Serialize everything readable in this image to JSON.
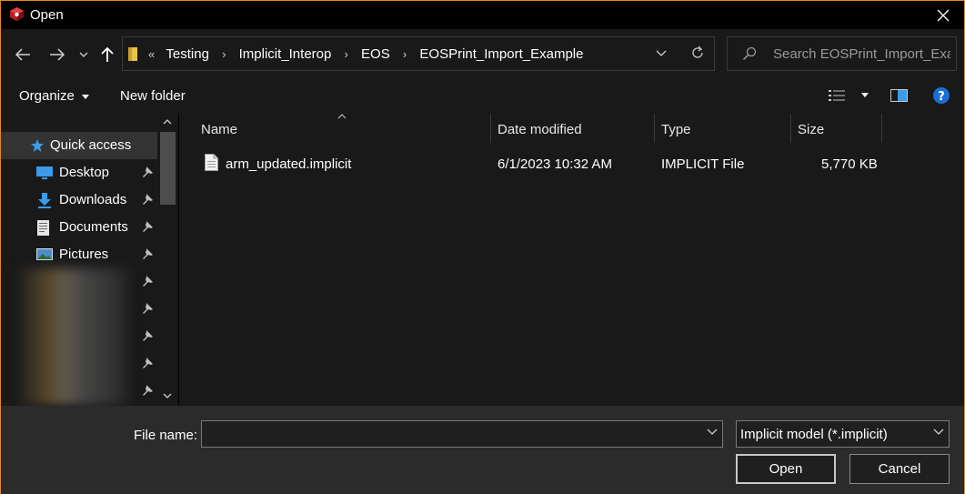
{
  "window": {
    "title": "Open"
  },
  "address": {
    "crumbs": [
      "Testing",
      "Implicit_Interop",
      "EOS",
      "EOSPrint_Import_Example"
    ]
  },
  "search": {
    "placeholder": "Search EOSPrint_Import_Exa..."
  },
  "toolbar": {
    "organize_label": "Organize",
    "new_folder_label": "New folder"
  },
  "sidebar": {
    "items": [
      {
        "label": "Quick access"
      },
      {
        "label": "Desktop"
      },
      {
        "label": "Downloads"
      },
      {
        "label": "Documents"
      },
      {
        "label": "Pictures"
      }
    ]
  },
  "columns": {
    "name": "Name",
    "date": "Date modified",
    "type": "Type",
    "size": "Size"
  },
  "files": [
    {
      "name": "arm_updated.implicit",
      "date": "6/1/2023 10:32 AM",
      "type": "IMPLICIT File",
      "size": "5,770 KB"
    }
  ],
  "bottom": {
    "file_name_label": "File name:",
    "file_name_value": "",
    "file_type_value": "Implicit model (*.implicit)",
    "open_label": "Open",
    "cancel_label": "Cancel"
  },
  "colors": {
    "accent_border": "#e08a1e",
    "folder_yellow": "#e8c24a",
    "star_blue": "#3a9be8"
  }
}
